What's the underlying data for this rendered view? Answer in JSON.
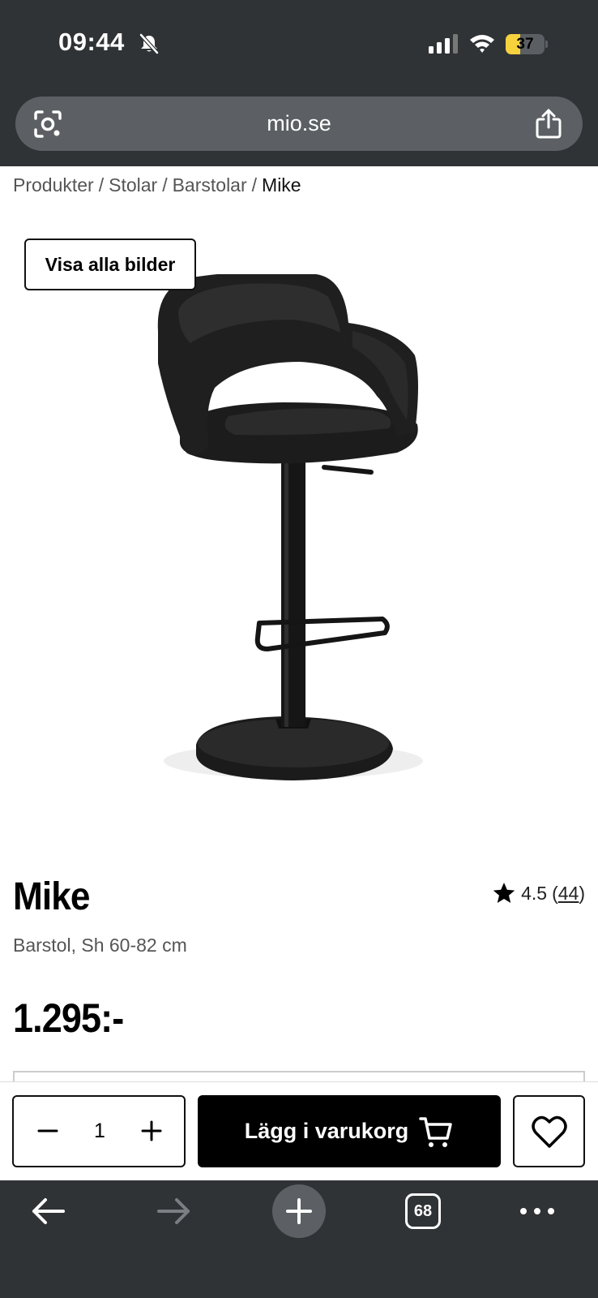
{
  "status_bar": {
    "time": "09:44",
    "battery_level": "37",
    "battery_fraction": 0.37,
    "battery_color": "#f7d23d",
    "icons": [
      "bell-slash-icon",
      "cellular-signal-icon",
      "wifi-icon",
      "battery-icon"
    ]
  },
  "browser": {
    "url": "mio.se",
    "tab_count": "68",
    "icons": [
      "visual-search-icon",
      "share-icon",
      "back-arrow-icon",
      "forward-arrow-icon",
      "new-tab-plus-icon",
      "more-dots-icon"
    ]
  },
  "breadcrumb": {
    "items": [
      "Produkter",
      "Stolar",
      "Barstolar",
      "Mike"
    ],
    "separator": "/"
  },
  "product": {
    "show_all_images_label": "Visa alla bilder",
    "title": "Mike",
    "rating": "4.5",
    "rating_count": "44",
    "rating_open": "(",
    "rating_close": ")",
    "subtitle": "Barstol, Sh 60-82 cm",
    "price": "1.295:-"
  },
  "cart_bar": {
    "quantity": "1",
    "add_to_cart_label": "Lägg i varukorg",
    "icons": [
      "minus-icon",
      "plus-icon",
      "shopping-cart-icon",
      "heart-icon"
    ]
  },
  "colors": {
    "chrome": "#303336",
    "urlbar": "#5c6064",
    "primary_button": "#000000"
  }
}
